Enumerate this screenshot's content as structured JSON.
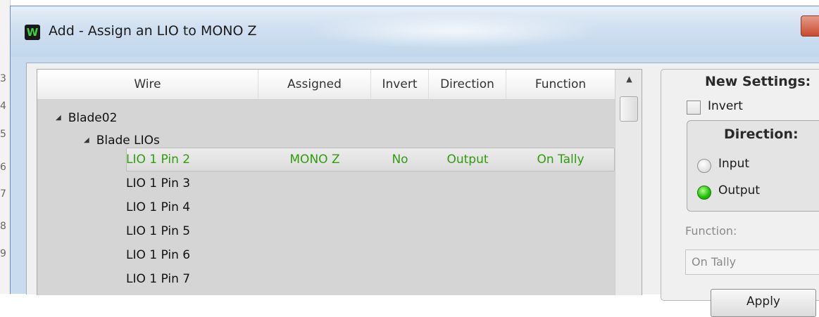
{
  "window": {
    "title": "Add - Assign an LIO to MONO Z",
    "icon": "W"
  },
  "columns": [
    "Wire",
    "Assigned",
    "Invert",
    "Direction",
    "Function"
  ],
  "tree": {
    "root_label": "Blade02",
    "group_label": "Blade LIOs",
    "rows": [
      {
        "wire": "LIO 1 Pin 2",
        "assigned": "MONO Z",
        "invert": "No",
        "direction": "Output",
        "function": "On Tally",
        "selected": true
      },
      {
        "wire": "LIO 1 Pin 3",
        "assigned": "",
        "invert": "",
        "direction": "",
        "function": ""
      },
      {
        "wire": "LIO 1 Pin 4",
        "assigned": "",
        "invert": "",
        "direction": "",
        "function": ""
      },
      {
        "wire": "LIO 1 Pin 5",
        "assigned": "",
        "invert": "",
        "direction": "",
        "function": ""
      },
      {
        "wire": "LIO 1 Pin 6",
        "assigned": "",
        "invert": "",
        "direction": "",
        "function": ""
      },
      {
        "wire": "LIO 1 Pin 7",
        "assigned": "",
        "invert": "",
        "direction": "",
        "function": ""
      }
    ]
  },
  "settings": {
    "title": "New Settings:",
    "invert_label": "Invert",
    "invert_checked": false,
    "direction_title": "Direction:",
    "input_label": "Input",
    "output_label": "Output",
    "direction_selected": "Output",
    "function_label": "Function:",
    "function_value": "On Tally",
    "apply_label": "Apply"
  },
  "background_numbers": [
    "3",
    "4",
    "5",
    "6",
    "7",
    "8",
    "9"
  ],
  "colors": {
    "selected_text": "#2f9d0b",
    "radio_on": "#22c40b"
  }
}
